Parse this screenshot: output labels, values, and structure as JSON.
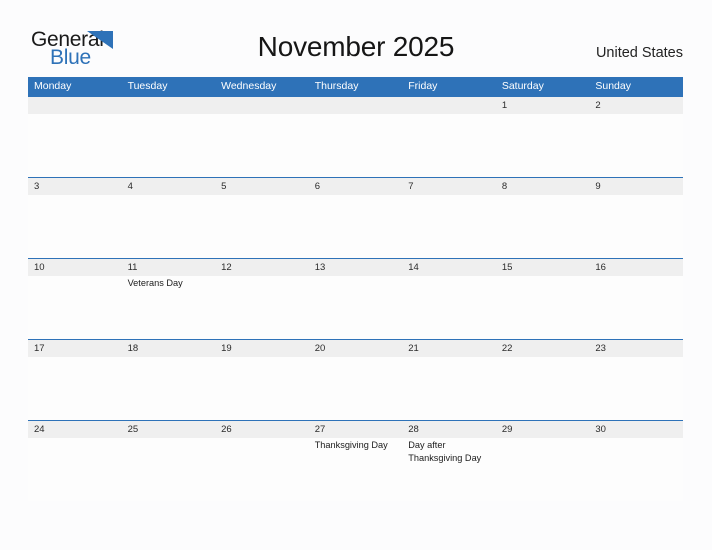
{
  "brand": {
    "word_one": "General",
    "word_two": "Blue",
    "triangle_color": "#2E72B8",
    "logo_icon": "triangle-flag-icon"
  },
  "header": {
    "title": "November 2025",
    "country": "United States"
  },
  "theme": {
    "header_blue": "#2E72B8",
    "date_strip_gray": "#efefef",
    "page_background": "#fcfcfd",
    "text_dark": "#1a1a1a"
  },
  "calendar": {
    "weekday_headers": [
      "Monday",
      "Tuesday",
      "Wednesday",
      "Thursday",
      "Friday",
      "Saturday",
      "Sunday"
    ],
    "weeks": [
      {
        "days": [
          {
            "number": "",
            "events": []
          },
          {
            "number": "",
            "events": []
          },
          {
            "number": "",
            "events": []
          },
          {
            "number": "",
            "events": []
          },
          {
            "number": "",
            "events": []
          },
          {
            "number": "1",
            "events": []
          },
          {
            "number": "2",
            "events": []
          }
        ]
      },
      {
        "days": [
          {
            "number": "3",
            "events": []
          },
          {
            "number": "4",
            "events": []
          },
          {
            "number": "5",
            "events": []
          },
          {
            "number": "6",
            "events": []
          },
          {
            "number": "7",
            "events": []
          },
          {
            "number": "8",
            "events": []
          },
          {
            "number": "9",
            "events": []
          }
        ]
      },
      {
        "days": [
          {
            "number": "10",
            "events": []
          },
          {
            "number": "11",
            "events": [
              "Veterans Day"
            ]
          },
          {
            "number": "12",
            "events": []
          },
          {
            "number": "13",
            "events": []
          },
          {
            "number": "14",
            "events": []
          },
          {
            "number": "15",
            "events": []
          },
          {
            "number": "16",
            "events": []
          }
        ]
      },
      {
        "days": [
          {
            "number": "17",
            "events": []
          },
          {
            "number": "18",
            "events": []
          },
          {
            "number": "19",
            "events": []
          },
          {
            "number": "20",
            "events": []
          },
          {
            "number": "21",
            "events": []
          },
          {
            "number": "22",
            "events": []
          },
          {
            "number": "23",
            "events": []
          }
        ]
      },
      {
        "days": [
          {
            "number": "24",
            "events": []
          },
          {
            "number": "25",
            "events": []
          },
          {
            "number": "26",
            "events": []
          },
          {
            "number": "27",
            "events": [
              "Thanksgiving Day"
            ]
          },
          {
            "number": "28",
            "events": [
              "Day after Thanksgiving Day"
            ]
          },
          {
            "number": "29",
            "events": []
          },
          {
            "number": "30",
            "events": []
          }
        ]
      }
    ]
  }
}
